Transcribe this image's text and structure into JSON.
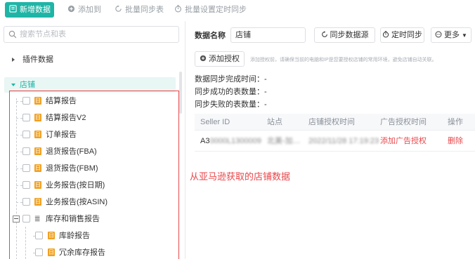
{
  "toolbar": {
    "new_data": "新增数据",
    "add_to": "添加到",
    "batch_sync_table": "批量同步表",
    "batch_schedule_sync": "批量设置定时同步"
  },
  "sidebar": {
    "search_placeholder": "搜索节点和表",
    "plugin_data": "插件数据",
    "shop": "店铺",
    "items": [
      {
        "tag": "日",
        "label": "结算报告"
      },
      {
        "tag": "日",
        "label": "结算报告V2"
      },
      {
        "tag": "日",
        "label": "订单报告"
      },
      {
        "tag": "日",
        "label": "退货报告(FBA)"
      },
      {
        "tag": "日",
        "label": "退货报告(FBM)"
      },
      {
        "tag": "日",
        "label": "业务报告(按日期)"
      },
      {
        "tag": "日",
        "label": "业务报告(按ASIN)"
      }
    ],
    "group": {
      "icon": "䷀",
      "label": "库存和销售报告"
    },
    "children": [
      {
        "tag": "日",
        "label": "库龄报告"
      },
      {
        "tag": "日",
        "label": "冗余库存报告"
      }
    ]
  },
  "main": {
    "name_label": "数据名称",
    "name_value": "店铺",
    "sync_source_button": "同步数据源",
    "schedule_sync_button": "定时同步",
    "more_button": "更多",
    "add_auth_button": "添加授权",
    "hint": "添加授权前，请确保当前的电脑和IP是您要授权店铺的常用环境，避免店铺自动关联。",
    "stats": [
      "数据同步完成时间：-",
      "同步成功的表数量：-",
      "同步失败的表数量：-"
    ],
    "table": {
      "headers": [
        "Seller ID",
        "站点",
        "店铺授权时间",
        "广告授权时间",
        "操作"
      ],
      "rows": [
        {
          "seller_id_prefix": "A3",
          "seller_id_blur": "0000L1300009",
          "site_blur": "北美-加…",
          "shop_auth_time_blur": "2022/11/28 17:19:23",
          "ad_auth": "添加广告授权",
          "action": "删除"
        }
      ]
    }
  },
  "annotation": "从亚马逊获取的店铺数据",
  "colors": {
    "accent": "#1fb5a6",
    "danger": "#e8474b",
    "tag": "#f0a020"
  }
}
